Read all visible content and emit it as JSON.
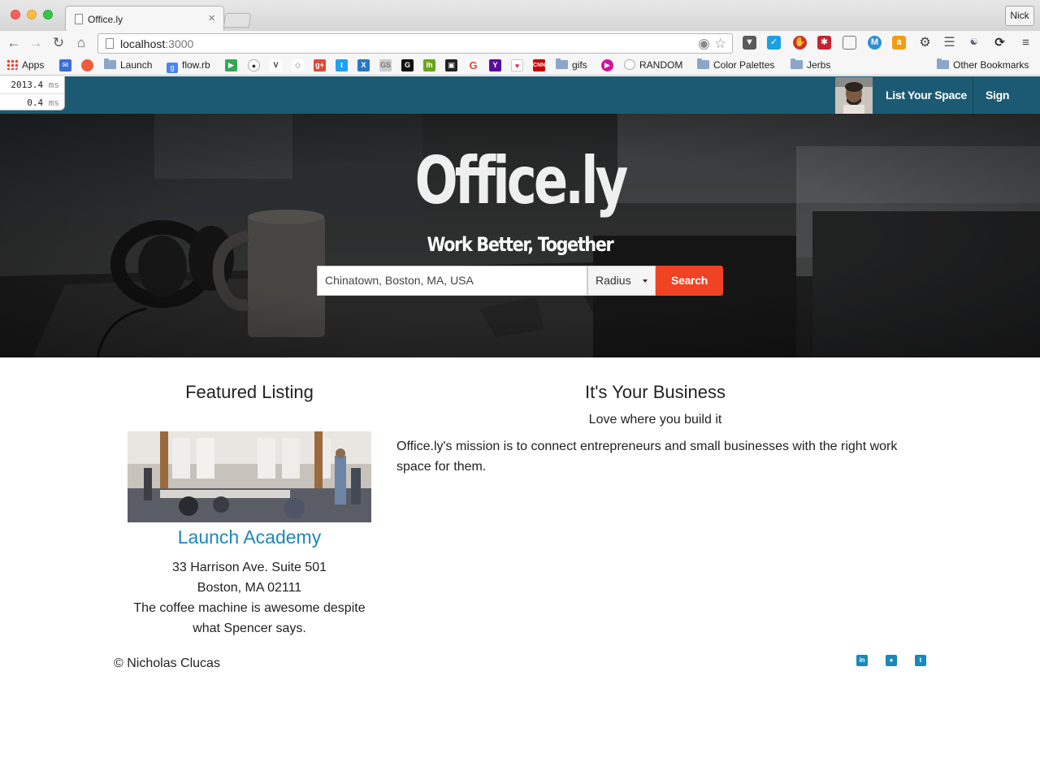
{
  "browser": {
    "tab_title": "Office.ly",
    "tab_close": "×",
    "profile_name": "Nick",
    "url_host": "localhost",
    "url_port": ":3000",
    "bookmarks": [
      {
        "label": "Apps",
        "icon": "apps-grid-icon"
      },
      {
        "label": "Launch",
        "icon": "folder-icon"
      },
      {
        "label": "flow.rb",
        "icon": "google-icon"
      },
      {
        "label": "gifs",
        "icon": "folder-icon"
      },
      {
        "label": "RANDOM",
        "icon": "reddit-icon"
      },
      {
        "label": "Color Palettes",
        "icon": "folder-icon"
      },
      {
        "label": "Jerbs",
        "icon": "folder-icon"
      },
      {
        "label": "Other Bookmarks",
        "icon": "folder-icon"
      }
    ]
  },
  "profiler": {
    "rows": [
      {
        "value": "2013.4",
        "unit": "ms"
      },
      {
        "value": "0.4",
        "unit": "ms"
      }
    ]
  },
  "navbar": {
    "list_space": "List Your Space",
    "sign_out": "Sign Out"
  },
  "hero": {
    "brand": "Office.ly",
    "tagline": "Work Better, Together",
    "search_value": "Chinatown, Boston, MA, USA",
    "radius_label": "Radius",
    "search_button": "Search"
  },
  "featured": {
    "heading": "Featured Listing",
    "name": "Launch Academy",
    "address1": "33 Harrison Ave. Suite 501",
    "address2": "Boston, MA 02111",
    "description": "The coffee machine is awesome despite what Spencer says."
  },
  "business": {
    "heading": "It's Your Business",
    "subheading": "Love where you build it",
    "mission": "Office.ly's mission is to connect entrepreneurs and small businesses with the right work space for them."
  },
  "footer": {
    "copyright": "© Nicholas Clucas",
    "social": [
      "linkedin-icon",
      "github-icon",
      "twitter-icon"
    ]
  },
  "colors": {
    "navbar": "#1c5a73",
    "accent_button": "#ef4323",
    "link": "#1b88ba"
  }
}
